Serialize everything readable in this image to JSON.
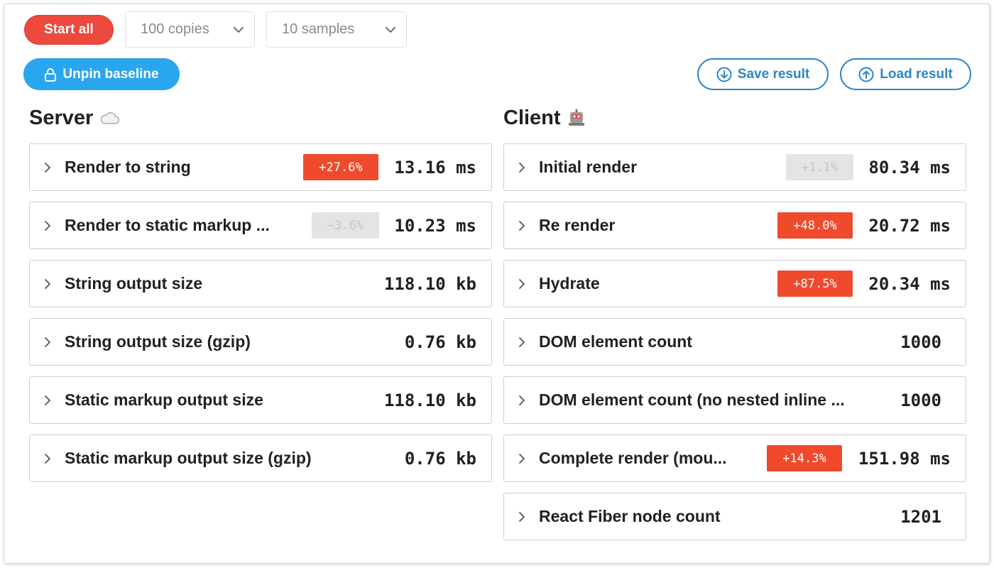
{
  "toolbar": {
    "start_label": "Start all",
    "copies_value": "100 copies",
    "samples_value": "10 samples",
    "unpin_label": "Unpin baseline",
    "save_label": "Save result",
    "load_label": "Load result"
  },
  "server": {
    "title": "Server",
    "rows": [
      {
        "label": "Render to string",
        "badge": "+27.6%",
        "value": "13.16 ms"
      },
      {
        "label": "Render to static markup ...",
        "badge": "−3.6%",
        "value": "10.23 ms"
      },
      {
        "label": "String output size",
        "value": "118.10 kb"
      },
      {
        "label": "String output size (gzip)",
        "value": "0.76 kb"
      },
      {
        "label": "Static markup output size",
        "value": "118.10 kb"
      },
      {
        "label": "Static markup output size (gzip)",
        "value": "0.76 kb"
      }
    ]
  },
  "client": {
    "title": "Client",
    "rows": [
      {
        "label": "Initial render",
        "badge": "+1.1%",
        "value": "80.34 ms"
      },
      {
        "label": "Re render",
        "badge": "+48.0%",
        "value": "20.72 ms"
      },
      {
        "label": "Hydrate",
        "badge": "+87.5%",
        "value": "20.34 ms"
      },
      {
        "label": "DOM element count",
        "value": "1000"
      },
      {
        "label": "DOM element count (no nested inline ...",
        "value": "1000"
      },
      {
        "label": "Complete render (mou...",
        "badge": "+14.3%",
        "value": "151.98 ms"
      },
      {
        "label": "React Fiber node count",
        "value": "1201"
      }
    ]
  },
  "colors": {
    "start_red": "#ec4a3d",
    "pin_blue": "#2aa6ee",
    "outline_blue": "#2b86c9",
    "badge_red": "#f04a2d",
    "badge_neutral": "#e4e4e4"
  }
}
